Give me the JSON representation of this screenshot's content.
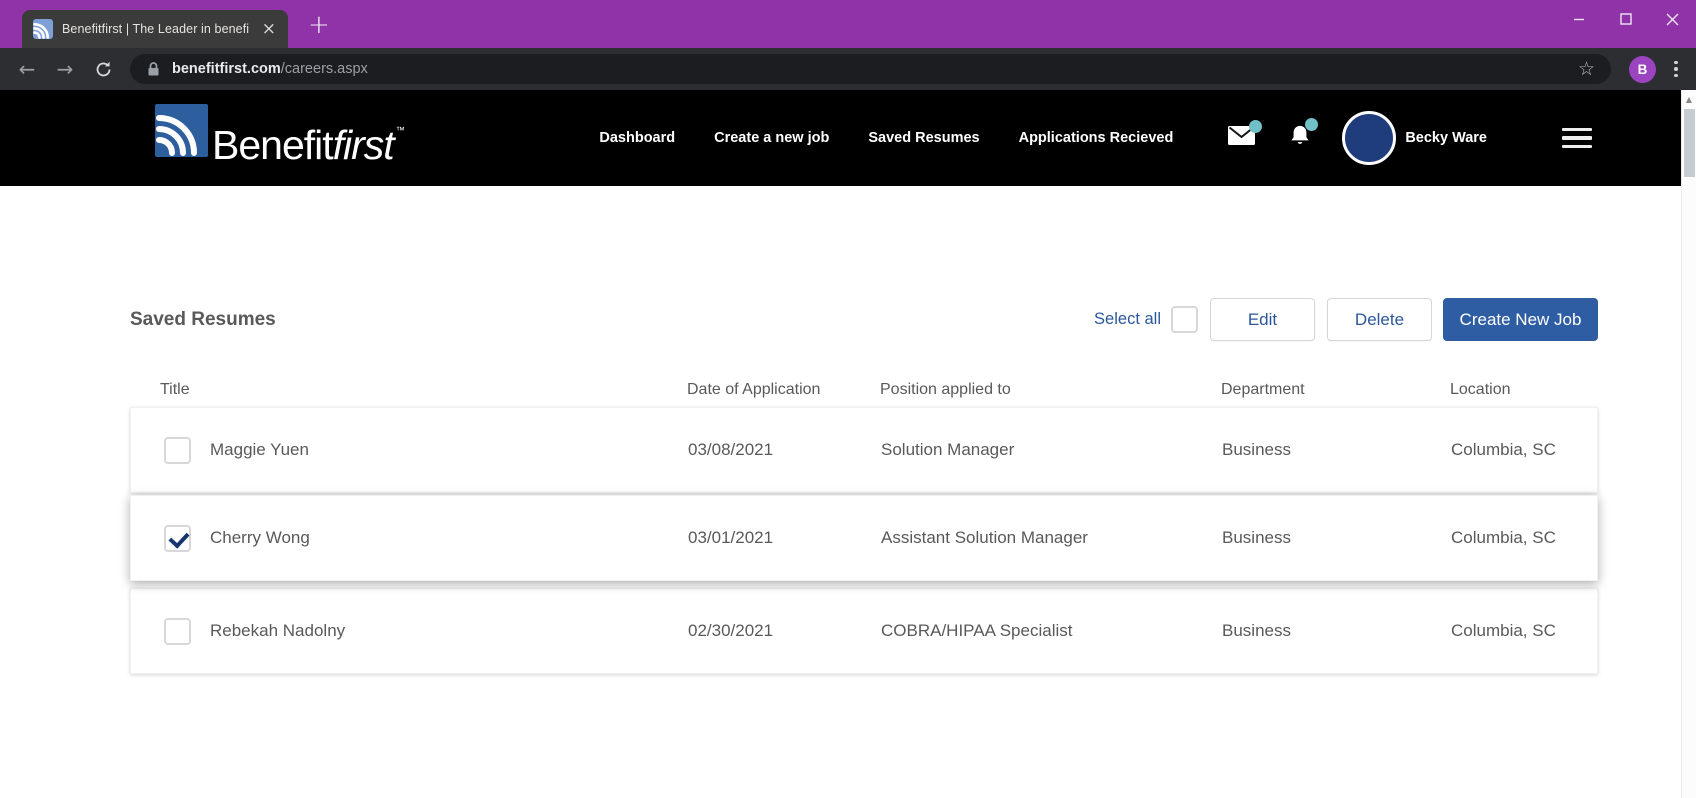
{
  "browser": {
    "tab_title": "Benefitfirst | The Leader in benefi",
    "tab_close_glyph": "×",
    "new_tab_glyph": "+",
    "url": {
      "domain": "benefitfirst.com",
      "path": "/careers.aspx"
    },
    "profile_initial": "B",
    "back_glyph": "←",
    "forward_glyph": "→",
    "star_glyph": "☆",
    "scroll_up_glyph": "▲"
  },
  "site_header": {
    "brand": {
      "part1": "Benefit",
      "part2": "first",
      "tm": "™"
    },
    "nav": [
      {
        "label": "Dashboard"
      },
      {
        "label": "Create a new job"
      },
      {
        "label": "Saved Resumes"
      },
      {
        "label": "Applications Recieved"
      }
    ],
    "user_name": "Becky Ware"
  },
  "main": {
    "title": "Saved Resumes",
    "select_all_label": "Select all",
    "buttons": {
      "edit": "Edit",
      "delete": "Delete",
      "create": "Create New Job"
    },
    "table": {
      "columns": [
        "Title",
        "Date of Application",
        "Position applied to",
        "Department",
        "Location"
      ],
      "rows": [
        {
          "checked": false,
          "title": "Maggie Yuen",
          "date": "03/08/2021",
          "position": "Solution Manager",
          "department": "Business",
          "location": "Columbia, SC"
        },
        {
          "checked": true,
          "title": "Cherry Wong",
          "date": "03/01/2021",
          "position": "Assistant Solution Manager",
          "department": "Business",
          "location": "Columbia, SC"
        },
        {
          "checked": false,
          "title": "Rebekah Nadolny",
          "date": "02/30/2021",
          "position": "COBRA/HIPAA Specialist",
          "department": "Business",
          "location": "Columbia, SC"
        }
      ]
    }
  },
  "colors": {
    "titlebar_purple": "#9032a8",
    "header_black": "#000000",
    "logo_blue": "#2d5f9e",
    "favicon_blue": "#7da0d8",
    "notification_teal": "#72c0c7",
    "avatar_navy": "#1f3d7c",
    "accent_blue": "#2b579a",
    "create_button_blue": "#2e5da4",
    "text_gray": "#595959"
  }
}
